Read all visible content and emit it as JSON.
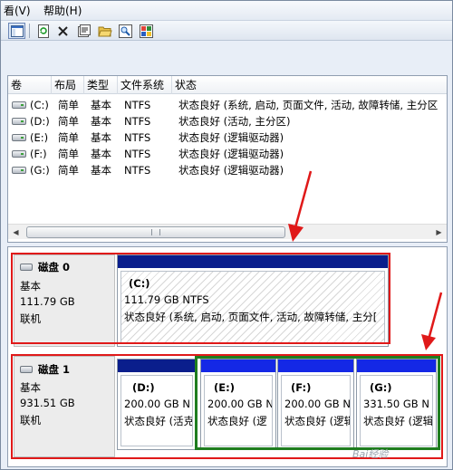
{
  "menu": [
    {
      "label": "看(V)"
    },
    {
      "label": "帮助(H)"
    }
  ],
  "toolbar": {
    "buttons": [
      {
        "name": "console-tree-button",
        "icon": "console-tree-icon"
      },
      {
        "name": "refresh-button",
        "icon": "refresh-icon"
      },
      {
        "name": "delete-button",
        "icon": "close-icon"
      },
      {
        "name": "properties-button",
        "icon": "properties-icon"
      },
      {
        "name": "open-button",
        "icon": "folder-open-icon"
      },
      {
        "name": "explore-button",
        "icon": "magnifier-icon"
      },
      {
        "name": "help-button",
        "icon": "help-icon"
      }
    ]
  },
  "volumes": {
    "columns": [
      "卷",
      "布局",
      "类型",
      "文件系统",
      "状态"
    ],
    "rows": [
      {
        "volume": "(C:)",
        "layout": "简单",
        "type": "基本",
        "fs": "NTFS",
        "status": "状态良好 (系统, 启动, 页面文件, 活动, 故障转储, 主分区"
      },
      {
        "volume": "(D:)",
        "layout": "简单",
        "type": "基本",
        "fs": "NTFS",
        "status": "状态良好 (活动, 主分区)"
      },
      {
        "volume": "(E:)",
        "layout": "简单",
        "type": "基本",
        "fs": "NTFS",
        "status": "状态良好 (逻辑驱动器)"
      },
      {
        "volume": "(F:)",
        "layout": "简单",
        "type": "基本",
        "fs": "NTFS",
        "status": "状态良好 (逻辑驱动器)"
      },
      {
        "volume": "(G:)",
        "layout": "简单",
        "type": "基本",
        "fs": "NTFS",
        "status": "状态良好 (逻辑驱动器)"
      }
    ]
  },
  "disks": [
    {
      "title": "磁盘 0",
      "type": "基本",
      "size": "111.79 GB",
      "status": "联机",
      "partitions": [
        {
          "name": "(C:)",
          "size": "111.79 GB NTFS",
          "status": "状态良好 (系统, 启动, 页面文件, 活动, 故障转储, 主分[",
          "bar_color": "#0a1e8c",
          "hatched": true
        }
      ]
    },
    {
      "title": "磁盘 1",
      "type": "基本",
      "size": "931.51 GB",
      "status": "联机",
      "partitions": [
        {
          "name": "(D:)",
          "size": "200.00 GB N",
          "status": "状态良好 (活克",
          "bar_color": "#0a1e8c",
          "hatched": false
        },
        {
          "name": "(E:)",
          "size": "200.00 GB N",
          "status": "状态良好 (逻",
          "bar_color": "#1428e6",
          "hatched": false
        },
        {
          "name": "(F:)",
          "size": "200.00 GB N",
          "status": "状态良好 (逻辑",
          "bar_color": "#1428e6",
          "hatched": false
        },
        {
          "name": "(G:)",
          "size": "331.50 GB N",
          "status": "状态良好 (逻辑",
          "bar_color": "#1428e6",
          "hatched": false
        }
      ]
    }
  ],
  "annotation_colors": {
    "highlight": "#e01919",
    "group": "#1f7d1f"
  },
  "watermark": "Bai经验"
}
